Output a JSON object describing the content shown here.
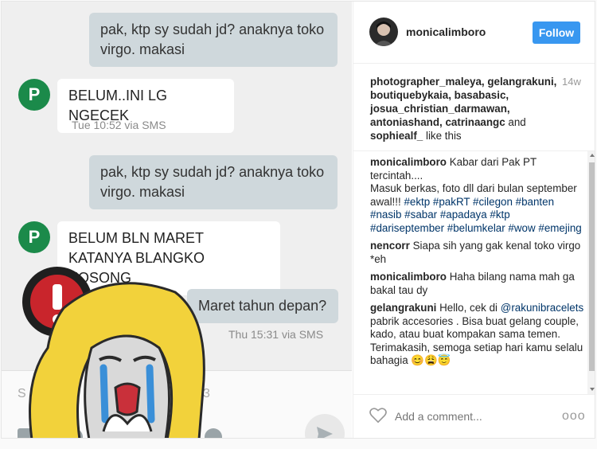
{
  "sms": {
    "messages": [
      {
        "text": "pak, ktp sy sudah jd? anaknya toko virgo. makasi"
      },
      {
        "text": "BELUM..INI LG NGECEK"
      },
      {
        "text": "pak, ktp sy sudah jd? anaknya toko virgo. makasi"
      },
      {
        "text": "BELUM BLN MARET KATANYA BLANGKO KOSONG"
      },
      {
        "text": "Maret tahun depan?"
      }
    ],
    "contact_initial": "P",
    "meta1": "Tue 10:52 via SMS",
    "meta2": "Thu 15:31 via SMS",
    "compose_left": "S",
    "compose_right": "3"
  },
  "instagram": {
    "username": "monicalimboro",
    "follow_label": "Follow",
    "likes": {
      "users": "photographer_maleya, gelangrakuni, boutiquebykaia, basabasic, josua_christian_darmawan, antoniashand, catrinaangc",
      "and": "and",
      "last": "sophiealf_",
      "suffix": "like this"
    },
    "time": "14w",
    "comments": [
      {
        "user": "monicalimboro",
        "text_a": "Kabar dari Pak PT tercintah....",
        "text_b": "Masuk berkas, foto dll dari bulan september awal!!!",
        "tags": "#ektp #pakRT #cilegon #banten #nasib #sabar #apadaya #ktp #dariseptember #belumkelar #wow #emejing"
      },
      {
        "user": "nencorr",
        "text": "Siapa sih yang gak kenal toko virgo *eh"
      },
      {
        "user": "monicalimboro",
        "text": "Haha bilang nama mah ga bakal tau dy"
      },
      {
        "user": "gelangrakuni",
        "text_a": "Hello, cek di",
        "mention": "@rakunibracelets",
        "text_b": "pabrik accesories . Bisa buat gelang couple, kado, atau buat kompakan sama temen. Terimakasih, semoga setiap hari kamu selalu bahagia 😊😩😇"
      }
    ],
    "add_comment_placeholder": "Add a comment...",
    "more_label": "ooo"
  },
  "colors": {
    "follow": "#3897f0",
    "tag": "#003569",
    "contact": "#1b8a4a"
  }
}
